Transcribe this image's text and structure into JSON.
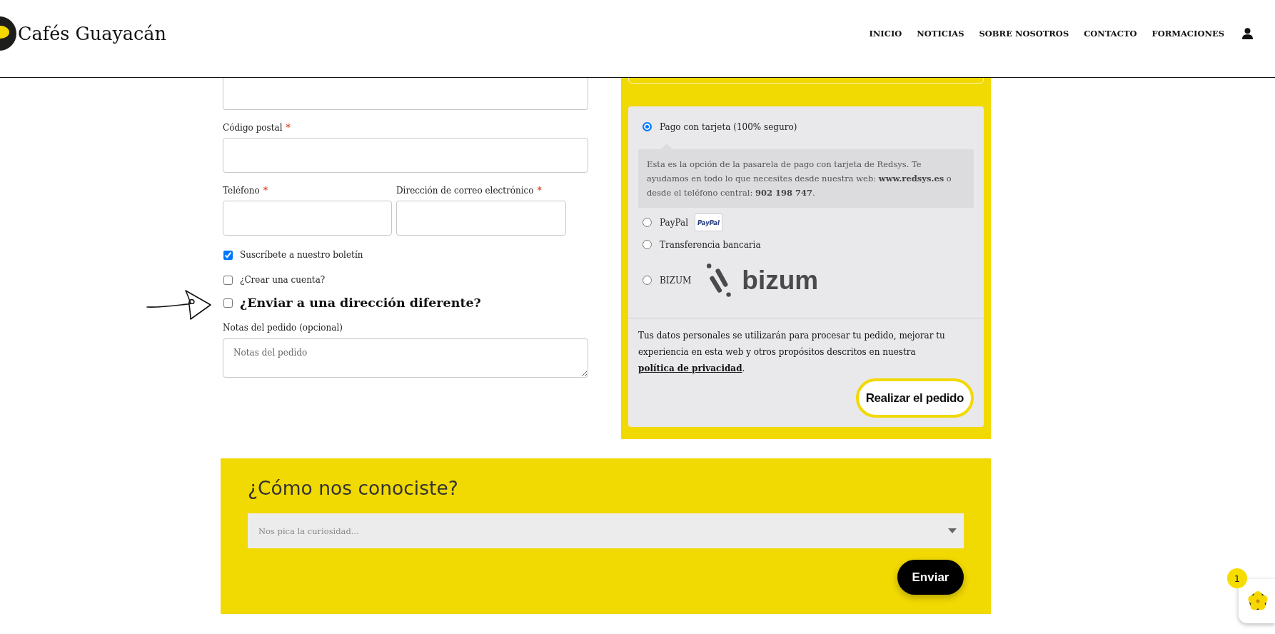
{
  "header": {
    "logo_text": "Cafés Guayacán",
    "nav": [
      {
        "label": "INICIO"
      },
      {
        "label": "NOTICIAS"
      },
      {
        "label": "SOBRE NOSOTROS"
      },
      {
        "label": "CONTACTO"
      },
      {
        "label": "FORMACIONES"
      }
    ]
  },
  "billing": {
    "rows": [
      [
        {
          "label": "Código postal",
          "required_mark": "*"
        }
      ],
      [
        {
          "label": "Teléfono",
          "required_mark": "*"
        },
        {
          "label": "Dirección de correo electrónico",
          "required_mark": "*"
        }
      ]
    ],
    "checkboxes": [
      {
        "kind": "option",
        "label": "Suscríbete a nuestro boletín",
        "checked": true
      },
      {
        "kind": "option",
        "label": "¿Crear una cuenta?",
        "checked": false
      },
      {
        "kind": "heading",
        "label": "¿Enviar a una dirección diferente?",
        "checked": false
      }
    ],
    "notes": {
      "label": "Notas del pedido (opcional)",
      "placeholder": "Notas del pedido"
    }
  },
  "payment": {
    "methods": [
      {
        "label": "Pago con tarjeta (100% seguro)",
        "selected": true,
        "description": "Esta es la opción de la pasarela de pago con tarjeta de Redsys. Te ayudamos en todo lo que necesites desde nuestra web: **www.redsys.es** o desde el teléfono central: **902 198 747**."
      },
      {
        "label": "PayPal",
        "selected": false,
        "logo": {
          "kind": "badge",
          "text": "PayPal"
        }
      },
      {
        "label": "Transferencia bancaria",
        "selected": false
      },
      {
        "label": "BIZUM",
        "selected": false,
        "logo": {
          "kind": "wordmark",
          "text": "bizum"
        }
      }
    ],
    "privacy": {
      "text": "Tus datos personales se utilizarán para procesar tu pedido, mejorar tu experiencia en esta web y otros propósitos descritos en nuestra",
      "link": "política de privacidad",
      "end": "."
    },
    "submit": "Realizar el pedido"
  },
  "survey": {
    "title": "¿Cómo nos conociste?",
    "placeholder": "Nos pica la curiosidad...",
    "submit": "Enviar"
  },
  "chat_widget": {
    "badge": "1"
  }
}
